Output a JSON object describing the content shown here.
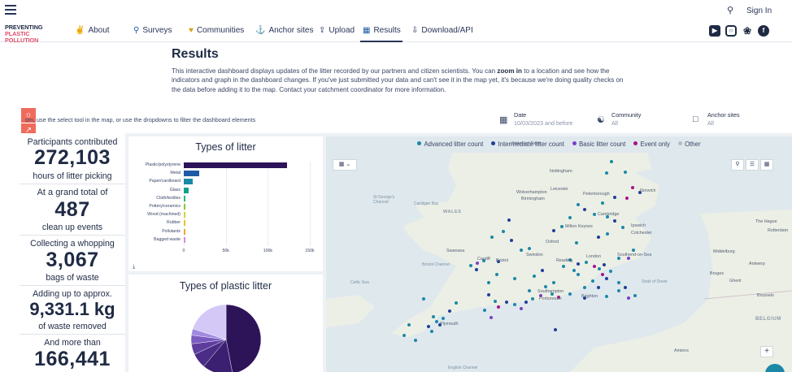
{
  "topbar": {
    "menu_icon": "hamburger-icon",
    "search_icon": "search-icon",
    "sign_in": "Sign In"
  },
  "nav": {
    "logo_line1": "PREVENTING",
    "logo_line2": "PLASTIC POLLUTION",
    "items": [
      {
        "label": "About",
        "icon": "megaphone-icon"
      },
      {
        "label": "Surveys",
        "icon": "magnifier-icon"
      },
      {
        "label": "Communities",
        "icon": "heart-icon"
      },
      {
        "label": "Anchor sites",
        "icon": "anchor-icon"
      },
      {
        "label": "Upload",
        "icon": "upload-icon"
      },
      {
        "label": "Results",
        "icon": "chart-icon"
      },
      {
        "label": "Download/API",
        "icon": "download-icon"
      }
    ],
    "active": "Results",
    "social": [
      "youtube-icon",
      "instagram-icon",
      "twitter-icon",
      "facebook-icon"
    ]
  },
  "page": {
    "title": "Results",
    "intro_1": "This interactive dashboard displays updates of the litter recorded by our partners and citizen scientists. You can ",
    "intro_bold": "zoom in",
    "intro_2": " to a location and see how the indicators and graph in the dashboard changes. If you've just submitted your data and can't see it in the map yet, it's because we're doing quality checks on the data before adding it to the map. Contact your catchment coordinator for more information."
  },
  "filters": {
    "hint": "om, use the select tool in the map, or use the dropdowns to filter the dashboard elements",
    "date": {
      "title": "Date",
      "value": "10/03/2023 and before"
    },
    "community": {
      "title": "Community",
      "value": "All"
    },
    "anchor": {
      "title": "Anchor sites",
      "value": "All"
    }
  },
  "stats": {
    "participants_label": "Participants contributed",
    "hours_value": "272,103",
    "hours_label": "hours of litter picking",
    "total_label": "At a grand total of",
    "events_value": "487",
    "events_label": "clean up events",
    "whopping_label": "Collecting a whopping",
    "bags_value": "3,067",
    "bags_label": "bags of waste",
    "approx_label": "Adding up to approx.",
    "weight_value": "9,331.1 kg",
    "weight_label": "of waste removed",
    "more_label": "And more than",
    "more_value": "166,441"
  },
  "chart_data": [
    {
      "type": "bar",
      "title": "Types of litter",
      "orientation": "horizontal",
      "categories": [
        "Plastic/polystyrene",
        "Metal",
        "Paper/cardboard",
        "Glass",
        "Cloth/textiles",
        "Pottery/ceramics",
        "Wood (machined)",
        "Rubber",
        "Pollutants",
        "Bagged waste"
      ],
      "values": [
        123000,
        18000,
        10500,
        6000,
        2200,
        1100,
        1100,
        1600,
        600,
        1300
      ],
      "colors": [
        "#2d1459",
        "#1f5aa6",
        "#1b88a8",
        "#14a088",
        "#2bb57a",
        "#8cc63f",
        "#c8d935",
        "#eec321",
        "#f0a830",
        "#d88ad8"
      ],
      "xticks": [
        "0",
        "50k",
        "100k",
        "150k"
      ],
      "xlim": [
        0,
        150000
      ]
    },
    {
      "type": "pie",
      "title": "Types of plastic litter",
      "values": [
        47,
        14,
        7,
        5,
        4,
        3,
        20
      ],
      "colors": [
        "#2d1459",
        "#3b1f70",
        "#4a2d86",
        "#5e3d9e",
        "#7a5bc0",
        "#a08be0",
        "#d4c8f7"
      ]
    }
  ],
  "map": {
    "legend": [
      {
        "label": "Advanced litter count",
        "color": "#1b88a8"
      },
      {
        "label": "Intermediate litter count",
        "color": "#1f3f9a"
      },
      {
        "label": "Basic litter count",
        "color": "#7a3fc4"
      },
      {
        "label": "Event only",
        "color": "#a8128a"
      },
      {
        "label": "Other",
        "color": "#b6bcc6"
      }
    ],
    "labels": [
      "Stoke-on-Trent",
      "Nottingham",
      "Norwich",
      "Leicester",
      "Wolverhampton",
      "Peterborough",
      "Birmingham",
      "Cambridge",
      "Ipswich",
      "Milton Keynes",
      "Colchester",
      "Swansea",
      "Oxford",
      "Cardiff",
      "Bristol",
      "Swindon",
      "Reading",
      "London",
      "Southend-on-Sea",
      "Southampton",
      "Portsmouth",
      "Brighton",
      "Plymouth",
      "Cardigan Bay",
      "WALES",
      "St George's Channel",
      "Bristol Channel",
      "Celtic Sea",
      "English Channel",
      "Strait of Dover",
      "The Hague",
      "Rotterdam",
      "Middelburg",
      "Antwerp",
      "Bruges",
      "Ghent",
      "Brussels",
      "BELGIUM",
      "Amiens"
    ]
  }
}
